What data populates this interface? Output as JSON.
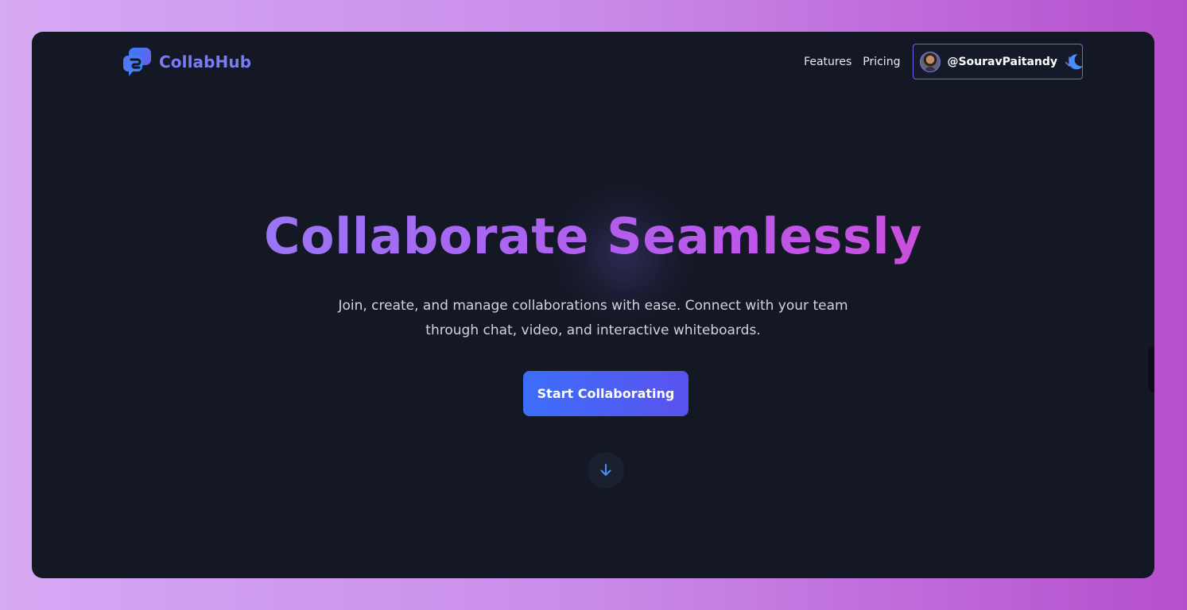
{
  "brand": {
    "name": "CollabHub"
  },
  "nav": {
    "links": [
      {
        "label": "Features"
      },
      {
        "label": "Pricing"
      }
    ],
    "user": {
      "handle": "@SouravPaitandy"
    }
  },
  "hero": {
    "title": "Collaborate Seamlessly",
    "subtitle_line1": "Join, create, and manage collaborations with ease. Connect with your team",
    "subtitle_line2": "through chat, video, and interactive whiteboards.",
    "cta_label": "Start Collaborating"
  },
  "icons": {
    "logo": "chat-bubbles-icon",
    "user_menu": "arrow-down-icon",
    "theme": "moon-icon",
    "scroll": "arrow-down-icon"
  },
  "colors": {
    "accent": "#6b64e8",
    "logo_text": "#7b7cf0",
    "cta_start": "#3c6ef9",
    "cta_end": "#5a52ee",
    "title_start": "#8b86f8",
    "title_end": "#df46c8",
    "panel_bg": "#141824"
  }
}
